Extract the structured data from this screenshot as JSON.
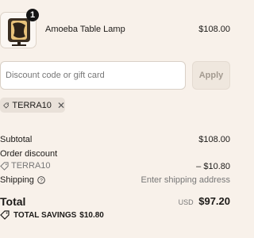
{
  "cart": {
    "item": {
      "name": "Amoeba Table Lamp",
      "price": "$108.00",
      "quantity": "1",
      "image_icon": "lamp-thumbnail"
    }
  },
  "discount": {
    "placeholder": "Discount code or gift card",
    "apply_label": "Apply",
    "applied_code": "TERRA10",
    "remove_icon": "close-icon"
  },
  "summary": {
    "subtotal_label": "Subtotal",
    "subtotal_value": "$108.00",
    "order_discount_label": "Order discount",
    "discount_code": "TERRA10",
    "discount_value": "– $10.80",
    "shipping_label": "Shipping",
    "shipping_value": "Enter shipping address",
    "total_label": "Total",
    "currency": "USD",
    "total_value": "$97.20",
    "savings_label": "TOTAL SAVINGS",
    "savings_value": "$10.80"
  },
  "colors": {
    "background": "#f8f1ea",
    "text": "#1c1a18",
    "muted": "#777777",
    "chip": "#e9e1d9"
  }
}
